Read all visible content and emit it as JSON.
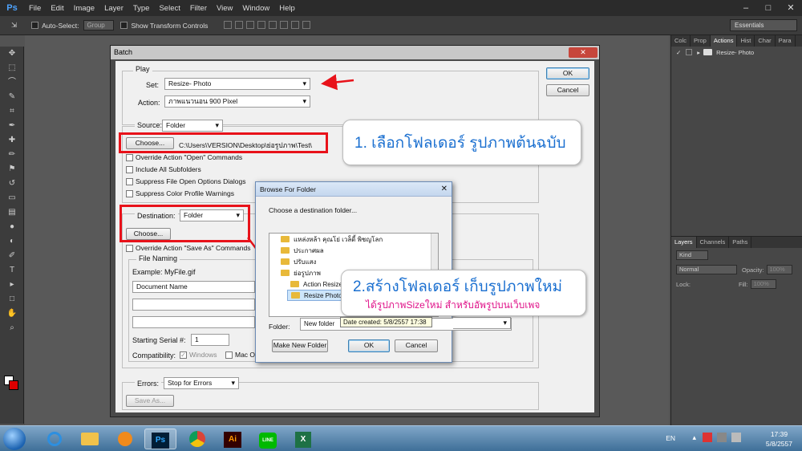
{
  "app": {
    "logo": "Ps",
    "menus": [
      "File",
      "Edit",
      "Image",
      "Layer",
      "Type",
      "Select",
      "Filter",
      "View",
      "Window",
      "Help"
    ],
    "window_controls": [
      "–",
      "□",
      "✕"
    ]
  },
  "options_bar": {
    "tool_icon": "⇲",
    "auto_select_label": "Auto-Select:",
    "auto_select_value": "Group",
    "show_transform_label": "Show Transform Controls",
    "workspace": "Essentials"
  },
  "panels": {
    "top_tabs": [
      "Colc",
      "Prop",
      "Actions",
      "Hist",
      "Char",
      "Para"
    ],
    "action_item": "Resize- Photo",
    "layers_tabs": [
      "Layers",
      "Channels",
      "Paths"
    ],
    "kind_label": "Kind",
    "blend_mode": "Normal",
    "opacity_label": "Opacity:",
    "opacity_value": "100%",
    "lock_label": "Lock:",
    "fill_label": "Fill:",
    "fill_value": "100%"
  },
  "batch": {
    "title": "Batch",
    "close": "✕",
    "play_label": "Play",
    "set_label": "Set:",
    "set_value": "Resize- Photo",
    "action_label": "Action:",
    "action_value": "ภาพแนวนอน 900 Pixel",
    "ok_label": "OK",
    "cancel_label": "Cancel",
    "source_label": "Source:",
    "source_value": "Folder",
    "choose_label": "Choose...",
    "source_path": "C:\\Users\\VERSION\\Desktop\\ย่อรูปภาพ\\Test\\",
    "override_open": "Override Action \"Open\" Commands",
    "include_sub": "Include All Subfolders",
    "suppress_open": "Suppress File Open Options Dialogs",
    "suppress_color": "Suppress Color Profile Warnings",
    "destination_label": "Destination:",
    "destination_value": "Folder",
    "dest_choose_label": "Choose...",
    "override_save": "Override Action \"Save As\" Commands",
    "file_naming": "File Naming",
    "example": "Example: MyFile.gif",
    "naming_field1": "Document Name",
    "serial_label": "Starting Serial #:",
    "serial_value": "1",
    "compat_label": "Compatibility:",
    "compat_windows": "Windows",
    "compat_mac": "Mac OS",
    "errors_label": "Errors:",
    "errors_value": "Stop for Errors",
    "save_as_label": "Save As..."
  },
  "browse": {
    "title": "Browse For Folder",
    "close": "✕",
    "instruction": "Choose a destination folder...",
    "tree": [
      "แหล่งหล้า คุณโย่ เวล็ดี้ พิชญโลก",
      "ประกาศผล",
      "ปรับแสง",
      "ย่อรูปภาพ",
      "Action Resize",
      "Resize Photo"
    ],
    "folder_label": "Folder:",
    "folder_value": "New folder",
    "tooltip": "Date created: 5/8/2557 17:38",
    "make_new_folder": "Make New Folder",
    "ok_label": "OK",
    "cancel_label": "Cancel"
  },
  "callouts": {
    "step1": "1. เลือกโฟลเดอร์ รูปภาพต้นฉบับ",
    "step2_main": "2.สร้างโฟลเดอร์ เก็บรูปภาพใหม่",
    "step2_sub": "ได้รูปภาพSizeใหม่ สำหรับอัพรูปบนเว็บเพจ"
  },
  "taskbar": {
    "apps": [
      "IE",
      "Explorer",
      "Media",
      "Ps",
      "Chrome",
      "Ai",
      "LINE",
      "Excel"
    ],
    "ps_label": "Ps",
    "ai_label": "Ai",
    "line_label": "LINE",
    "lang": "EN",
    "time": "17:39",
    "date": "5/8/2557"
  },
  "colors": {
    "highlight": "#e8121a",
    "callout_blue": "#1a6fd0",
    "callout_pink": "#e0148a"
  }
}
